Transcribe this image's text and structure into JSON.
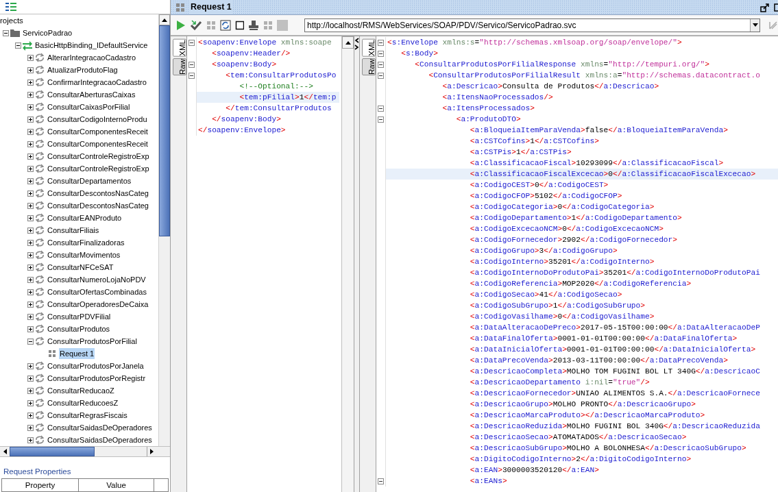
{
  "navigator": {
    "root_label": "rojects",
    "items": [
      {
        "label": "ServicoPadrao",
        "kind": "project",
        "expanded": true,
        "selected": false,
        "children": [
          {
            "label": "BasicHttpBinding_IDefaultService",
            "kind": "interface",
            "expanded": true,
            "selected": false,
            "children": [
              {
                "label": "AlterarIntegracaoCadastro",
                "kind": "operation",
                "expanded": false,
                "selected": false
              },
              {
                "label": "AtualizarProdutoFlag",
                "kind": "operation",
                "expanded": false,
                "selected": false
              },
              {
                "label": "ConfirmarIntegracaoCadastro",
                "kind": "operation",
                "expanded": false,
                "selected": false
              },
              {
                "label": "ConsultarAberturasCaixas",
                "kind": "operation",
                "expanded": false,
                "selected": false
              },
              {
                "label": "ConsultarCaixasPorFilial",
                "kind": "operation",
                "expanded": false,
                "selected": false
              },
              {
                "label": "ConsultarCodigoInternoProdu",
                "kind": "operation",
                "expanded": false,
                "selected": false
              },
              {
                "label": "ConsultarComponentesReceit",
                "kind": "operation",
                "expanded": false,
                "selected": false
              },
              {
                "label": "ConsultarComponentesReceit",
                "kind": "operation",
                "expanded": false,
                "selected": false
              },
              {
                "label": "ConsultarControleRegistroExp",
                "kind": "operation",
                "expanded": false,
                "selected": false
              },
              {
                "label": "ConsultarControleRegistroExp",
                "kind": "operation",
                "expanded": false,
                "selected": false
              },
              {
                "label": "ConsultarDepartamentos",
                "kind": "operation",
                "expanded": false,
                "selected": false
              },
              {
                "label": "ConsultarDescontosNasCateg",
                "kind": "operation",
                "expanded": false,
                "selected": false
              },
              {
                "label": "ConsultarDescontosNasCateg",
                "kind": "operation",
                "expanded": false,
                "selected": false
              },
              {
                "label": "ConsultarEANProduto",
                "kind": "operation",
                "expanded": false,
                "selected": false
              },
              {
                "label": "ConsultarFiliais",
                "kind": "operation",
                "expanded": false,
                "selected": false
              },
              {
                "label": "ConsultarFinalizadoras",
                "kind": "operation",
                "expanded": false,
                "selected": false
              },
              {
                "label": "ConsultarMovimentos",
                "kind": "operation",
                "expanded": false,
                "selected": false
              },
              {
                "label": "ConsultarNFCeSAT",
                "kind": "operation",
                "expanded": false,
                "selected": false
              },
              {
                "label": "ConsultarNumeroLojaNoPDV",
                "kind": "operation",
                "expanded": false,
                "selected": false
              },
              {
                "label": "ConsultarOfertasCombinadas",
                "kind": "operation",
                "expanded": false,
                "selected": false
              },
              {
                "label": "ConsultarOperadoresDeCaixa",
                "kind": "operation",
                "expanded": false,
                "selected": false
              },
              {
                "label": "ConsultarPDVFilial",
                "kind": "operation",
                "expanded": false,
                "selected": false
              },
              {
                "label": "ConsultarProdutos",
                "kind": "operation",
                "expanded": false,
                "selected": false
              },
              {
                "label": "ConsultarProdutosPorFilial",
                "kind": "operation",
                "expanded": true,
                "selected": false,
                "children": [
                  {
                    "label": "Request 1",
                    "kind": "request",
                    "selected": true
                  }
                ]
              },
              {
                "label": "ConsultarProdutosPorJanela",
                "kind": "operation",
                "expanded": false,
                "selected": false
              },
              {
                "label": "ConsultarProdutosPorRegistr",
                "kind": "operation",
                "expanded": false,
                "selected": false
              },
              {
                "label": "ConsultarReducaoZ",
                "kind": "operation",
                "expanded": false,
                "selected": false
              },
              {
                "label": "ConsultarReducoesZ",
                "kind": "operation",
                "expanded": false,
                "selected": false
              },
              {
                "label": "ConsultarRegrasFiscais",
                "kind": "operation",
                "expanded": false,
                "selected": false
              },
              {
                "label": "ConsultarSaidasDeOperadores",
                "kind": "operation",
                "expanded": false,
                "selected": false
              },
              {
                "label": "ConsultarSaidasDeOperadores",
                "kind": "operation",
                "expanded": false,
                "selected": false
              }
            ]
          }
        ]
      }
    ]
  },
  "properties_panel": {
    "title": "Request Properties",
    "columns": [
      "Property",
      "Value"
    ]
  },
  "editor": {
    "title": "Request 1",
    "url": "http://localhost/RMS/WebServices/SOAP/PDV/Servico/ServicoPadrao.svc",
    "request": {
      "tabs": [
        {
          "label": "XML",
          "selected": true
        },
        {
          "label": "Raw",
          "selected": false
        }
      ],
      "lines": [
        {
          "text": "<soapenv:Envelope xmlns:soape",
          "fold": true,
          "highlighted": false
        },
        {
          "text": "   <soapenv:Header/>",
          "fold": false,
          "highlighted": false
        },
        {
          "text": "   <soapenv:Body>",
          "fold": true,
          "highlighted": false
        },
        {
          "text": "      <tem:ConsultarProdutosPo",
          "fold": true,
          "highlighted": false
        },
        {
          "text": "         <!--Optional:-->",
          "fold": false,
          "highlighted": false
        },
        {
          "text": "         <tem:pFilial>1</tem:p",
          "fold": false,
          "highlighted": true
        },
        {
          "text": "      </tem:ConsultarProdutos",
          "fold": false,
          "highlighted": false
        },
        {
          "text": "   </soapenv:Body>",
          "fold": false,
          "highlighted": false
        },
        {
          "text": "</soapenv:Envelope>",
          "fold": false,
          "highlighted": false
        }
      ]
    },
    "response": {
      "tabs": [
        {
          "label": "XML",
          "selected": true
        },
        {
          "label": "Raw",
          "selected": false
        }
      ],
      "lines": [
        {
          "text": "<s:Envelope xmlns:s=\"http://schemas.xmlsoap.org/soap/envelope/\">",
          "fold": true,
          "highlighted": false
        },
        {
          "text": "   <s:Body>",
          "fold": true,
          "highlighted": false
        },
        {
          "text": "      <ConsultarProdutosPorFilialResponse xmlns=\"http://tempuri.org/\">",
          "fold": true,
          "highlighted": false
        },
        {
          "text": "         <ConsultarProdutosPorFilialResult xmlns:a=\"http://schemas.datacontract.o",
          "fold": true,
          "highlighted": false
        },
        {
          "text": "            <a:Descricao>Consulta de Produtos</a:Descricao>",
          "fold": false,
          "highlighted": false
        },
        {
          "text": "            <a:ItensNaoProcessados/>",
          "fold": false,
          "highlighted": false
        },
        {
          "text": "            <a:ItensProcessados>",
          "fold": true,
          "highlighted": false
        },
        {
          "text": "               <a:ProdutoDTO>",
          "fold": true,
          "highlighted": false
        },
        {
          "text": "                  <a:BloqueiaItemParaVenda>false</a:BloqueiaItemParaVenda>",
          "fold": false,
          "highlighted": false
        },
        {
          "text": "                  <a:CSTCofins>1</a:CSTCofins>",
          "fold": false,
          "highlighted": false
        },
        {
          "text": "                  <a:CSTPis>1</a:CSTPis>",
          "fold": false,
          "highlighted": false
        },
        {
          "text": "                  <a:ClassificacaoFiscal>10293099</a:ClassificacaoFiscal>",
          "fold": false,
          "highlighted": false
        },
        {
          "text": "                  <a:ClassificacaoFiscalExcecao>0</a:ClassificacaoFiscalExcecao>",
          "fold": false,
          "highlighted": true
        },
        {
          "text": "                  <a:CodigoCEST>0</a:CodigoCEST>",
          "fold": false,
          "highlighted": false
        },
        {
          "text": "                  <a:CodigoCFOP>5102</a:CodigoCFOP>",
          "fold": false,
          "highlighted": false
        },
        {
          "text": "                  <a:CodigoCategoria>0</a:CodigoCategoria>",
          "fold": false,
          "highlighted": false
        },
        {
          "text": "                  <a:CodigoDepartamento>1</a:CodigoDepartamento>",
          "fold": false,
          "highlighted": false
        },
        {
          "text": "                  <a:CodigoExcecaoNCM>0</a:CodigoExcecaoNCM>",
          "fold": false,
          "highlighted": false
        },
        {
          "text": "                  <a:CodigoFornecedor>2902</a:CodigoFornecedor>",
          "fold": false,
          "highlighted": false
        },
        {
          "text": "                  <a:CodigoGrupo>3</a:CodigoGrupo>",
          "fold": false,
          "highlighted": false
        },
        {
          "text": "                  <a:CodigoInterno>35201</a:CodigoInterno>",
          "fold": false,
          "highlighted": false
        },
        {
          "text": "                  <a:CodigoInternoDoProdutoPai>35201</a:CodigoInternoDoProdutoPai",
          "fold": false,
          "highlighted": false
        },
        {
          "text": "                  <a:CodigoReferencia>MOP2020</a:CodigoReferencia>",
          "fold": false,
          "highlighted": false
        },
        {
          "text": "                  <a:CodigoSecao>41</a:CodigoSecao>",
          "fold": false,
          "highlighted": false
        },
        {
          "text": "                  <a:CodigoSubGrupo>1</a:CodigoSubGrupo>",
          "fold": false,
          "highlighted": false
        },
        {
          "text": "                  <a:CodigoVasilhame>0</a:CodigoVasilhame>",
          "fold": false,
          "highlighted": false
        },
        {
          "text": "                  <a:DataAlteracaoDePreco>2017-05-15T00:00:00</a:DataAlteracaoDeP",
          "fold": false,
          "highlighted": false
        },
        {
          "text": "                  <a:DataFinalOferta>0001-01-01T00:00:00</a:DataFinalOferta>",
          "fold": false,
          "highlighted": false
        },
        {
          "text": "                  <a:DataInicialOferta>0001-01-01T00:00:00</a:DataInicialOferta>",
          "fold": false,
          "highlighted": false
        },
        {
          "text": "                  <a:DataPrecoVenda>2013-03-11T00:00:00</a:DataPrecoVenda>",
          "fold": false,
          "highlighted": false
        },
        {
          "text": "                  <a:DescricaoCompleta>MOLHO TOM FUGINI BOL LT 340G</a:DescricaoC",
          "fold": false,
          "highlighted": false
        },
        {
          "text": "                  <a:DescricaoDepartamento i:nil=\"true\"/>",
          "fold": false,
          "highlighted": false
        },
        {
          "text": "                  <a:DescricaoFornecedor>UNIAO ALIMENTOS S.A.</a:DescricaoFornece",
          "fold": false,
          "highlighted": false
        },
        {
          "text": "                  <a:DescricaoGrupo>MOLHO PRONTO</a:DescricaoGrupo>",
          "fold": false,
          "highlighted": false
        },
        {
          "text": "                  <a:DescricaoMarcaProduto></a:DescricaoMarcaProduto>",
          "fold": false,
          "highlighted": false
        },
        {
          "text": "                  <a:DescricaoReduzida>MOLHO FUGINI BOL 340G</a:DescricaoReduzida",
          "fold": false,
          "highlighted": false
        },
        {
          "text": "                  <a:DescricaoSecao>ATOMATADOS</a:DescricaoSecao>",
          "fold": false,
          "highlighted": false
        },
        {
          "text": "                  <a:DescricaoSubGrupo>MOLHO A BOLONHESA</a:DescricaoSubGrupo>",
          "fold": false,
          "highlighted": false
        },
        {
          "text": "                  <a:DigitoCodigoInterno>2</a:DigitoCodigoInterno>",
          "fold": false,
          "highlighted": false
        },
        {
          "text": "                  <a:EAN>3000003520120</a:EAN>",
          "fold": false,
          "highlighted": false
        },
        {
          "text": "                  <a:EANs>",
          "fold": true,
          "highlighted": false
        }
      ]
    }
  }
}
